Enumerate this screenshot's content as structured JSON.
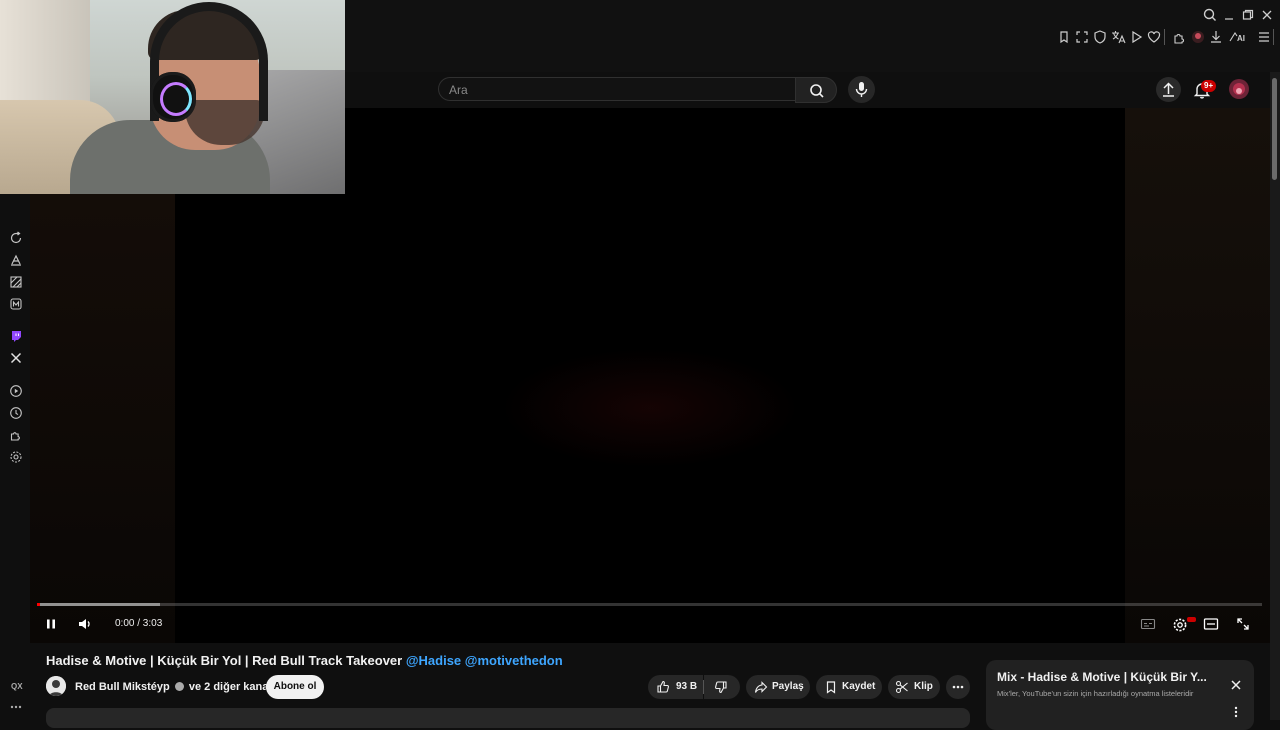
{
  "search": {
    "placeholder": "Ara"
  },
  "notifications": {
    "badge": "9+"
  },
  "player": {
    "time": "0:00 / 3:03",
    "progress_played_fraction": 0.0,
    "progress_buffered_fraction": 0.1
  },
  "video": {
    "title": "Hadise & Motive | Küçük Bir Yol | Red Bull Track Takeover",
    "mentions": [
      "@Hadise",
      "@motivethedon"
    ]
  },
  "channel": {
    "name": "Red Bull Mikstéyp",
    "collab": "ve 2 diğer kanal",
    "subscribe_label": "Abone ol"
  },
  "actions": {
    "likes": "93 B",
    "share_label": "Paylaş",
    "save_label": "Kaydet",
    "clip_label": "Klip"
  },
  "mix": {
    "title": "Mix - Hadise & Motive | Küçük Bir Y...",
    "subtitle": "Mix'ler, YouTube'un sizin için hazırladığı oynatma listeleridir"
  },
  "left_rail": {
    "footer_label": "QX"
  },
  "icons": [
    "search-icon",
    "minimize-icon",
    "restore-icon",
    "close-icon",
    "bookmark-icon",
    "screenshot-icon",
    "shield-icon",
    "translate-icon",
    "play-icon",
    "heart-icon",
    "extensions-icon",
    "download-icon",
    "ai-icon",
    "menu-icon",
    "mic-icon",
    "upload-icon",
    "bell-icon",
    "pause-icon",
    "volume-icon",
    "captions-icon",
    "settings-icon",
    "theater-icon",
    "fullscreen-icon",
    "like-icon",
    "dislike-icon",
    "share-icon",
    "save-icon",
    "clip-icon",
    "more-icon",
    "twitch-icon",
    "x-icon",
    "history-icon",
    "reload-icon"
  ],
  "colors": {
    "accent_red": "#ff0000",
    "mention_blue": "#3ea6ff",
    "background": "#0f0f0f"
  }
}
